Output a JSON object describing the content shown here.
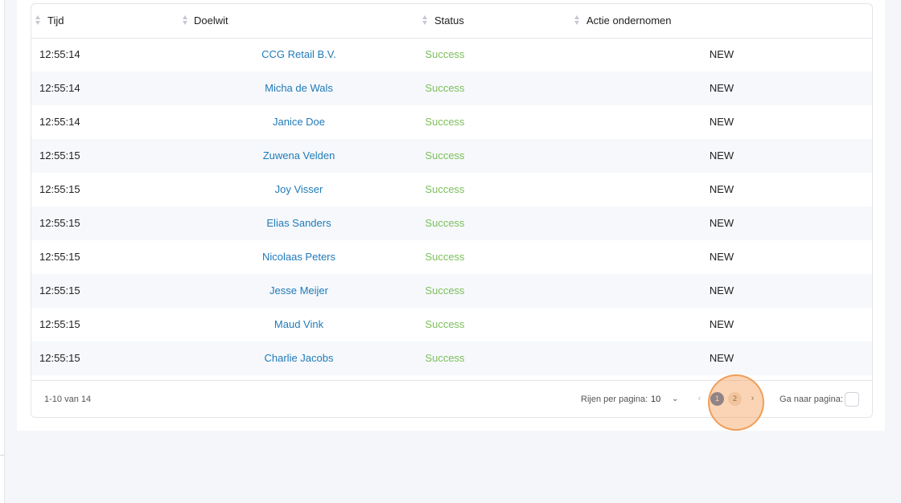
{
  "table": {
    "columns": [
      {
        "label": "Tijd"
      },
      {
        "label": "Doelwit"
      },
      {
        "label": "Status"
      },
      {
        "label": "Actie ondernomen"
      }
    ],
    "rows": [
      {
        "time": "12:55:14",
        "target": "CCG Retail B.V.",
        "status": "Success",
        "action": "NEW"
      },
      {
        "time": "12:55:14",
        "target": "Micha de Wals",
        "status": "Success",
        "action": "NEW"
      },
      {
        "time": "12:55:14",
        "target": "Janice Doe",
        "status": "Success",
        "action": "NEW"
      },
      {
        "time": "12:55:15",
        "target": "Zuwena Velden",
        "status": "Success",
        "action": "NEW"
      },
      {
        "time": "12:55:15",
        "target": "Joy Visser",
        "status": "Success",
        "action": "NEW"
      },
      {
        "time": "12:55:15",
        "target": "Elias Sanders",
        "status": "Success",
        "action": "NEW"
      },
      {
        "time": "12:55:15",
        "target": "Nicolaas Peters",
        "status": "Success",
        "action": "NEW"
      },
      {
        "time": "12:55:15",
        "target": "Jesse Meijer",
        "status": "Success",
        "action": "NEW"
      },
      {
        "time": "12:55:15",
        "target": "Maud Vink",
        "status": "Success",
        "action": "NEW"
      },
      {
        "time": "12:55:15",
        "target": "Charlie Jacobs",
        "status": "Success",
        "action": "NEW"
      }
    ]
  },
  "pagination": {
    "range_text": "1-10 van 14",
    "rows_per_page_label": "Rijen per pagina:",
    "rows_per_page_value": "10",
    "pages": [
      "1",
      "2"
    ],
    "current_page": "1",
    "goto_label": "Ga naar pagina:",
    "goto_value": ""
  },
  "icons": {
    "sort": "sort-icon",
    "prev": "chevron-left-icon",
    "next": "chevron-right-icon",
    "dropdown": "chevron-down-icon"
  },
  "colors": {
    "link": "#1f7ab8",
    "success": "#7cbf5a",
    "active_page": "#3f6ea8",
    "click_highlight": "#f4a05a"
  }
}
